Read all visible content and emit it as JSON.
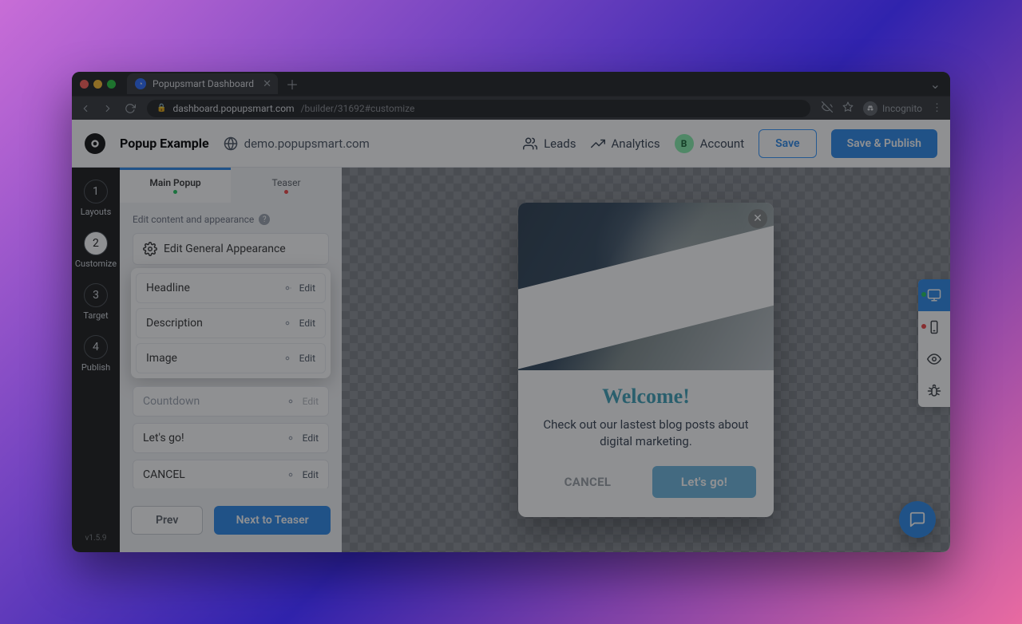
{
  "browser": {
    "tab_title": "Popupsmart Dashboard",
    "url_domain": "dashboard.popupsmart.com",
    "url_path": "/builder/31692#customize",
    "incognito": "Incognito"
  },
  "header": {
    "title": "Popup Example",
    "site": "demo.popupsmart.com",
    "leads": "Leads",
    "analytics": "Analytics",
    "account_letter": "B",
    "account": "Account",
    "save": "Save",
    "publish": "Save & Publish"
  },
  "steps": [
    {
      "num": "1",
      "label": "Layouts"
    },
    {
      "num": "2",
      "label": "Customize"
    },
    {
      "num": "3",
      "label": "Target"
    },
    {
      "num": "4",
      "label": "Publish"
    }
  ],
  "version": "v1.5.9",
  "panel": {
    "tab_main": "Main Popup",
    "tab_teaser": "Teaser",
    "hint": "Edit content and appearance",
    "general": "Edit General Appearance",
    "rows": {
      "headline": "Headline",
      "description": "Description",
      "image": "Image",
      "countdown": "Countdown",
      "letsgo": "Let's go!",
      "cancel": "CANCEL"
    },
    "edit": "Edit",
    "prev": "Prev",
    "next": "Next to Teaser"
  },
  "popup": {
    "headline": "Welcome!",
    "description": "Check out our lastest blog posts about digital marketing.",
    "cancel": "CANCEL",
    "go": "Let's go!"
  }
}
